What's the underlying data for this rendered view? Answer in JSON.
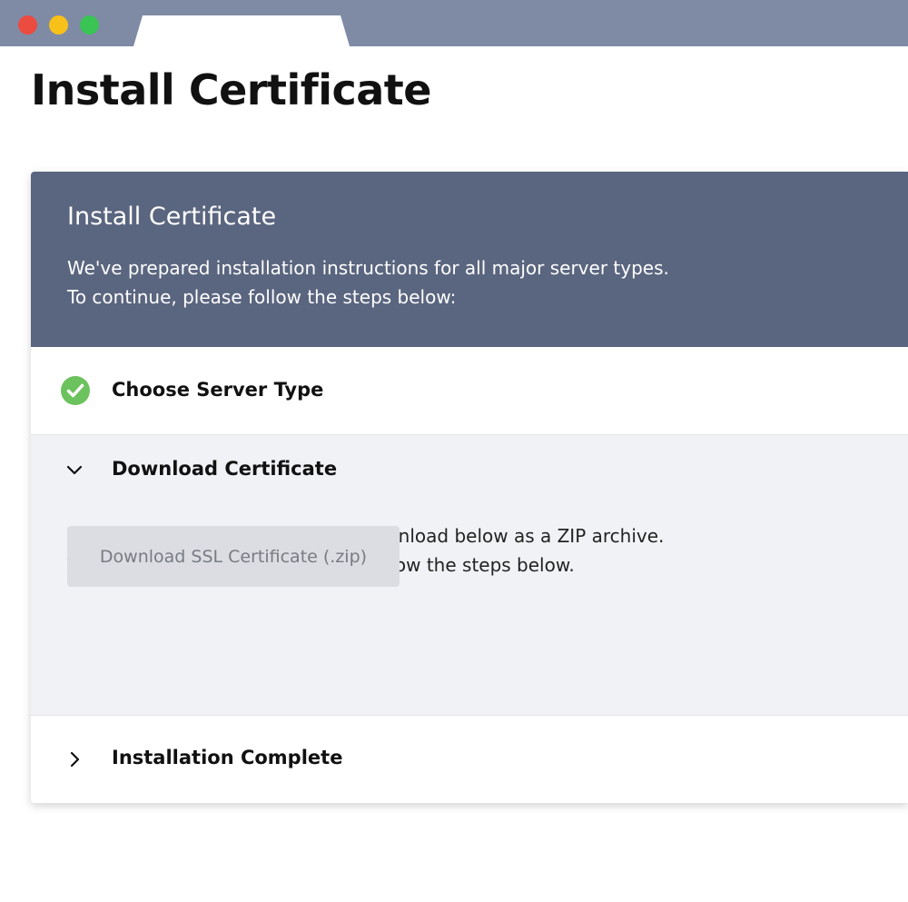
{
  "browser": {
    "traffic_lights": [
      {
        "name": "close",
        "color": "#ec4b40"
      },
      {
        "name": "minimize",
        "color": "#f8c11a"
      },
      {
        "name": "maximize",
        "color": "#39c454"
      }
    ]
  },
  "page": {
    "title": "Install Certificate"
  },
  "card": {
    "title": "Install Certificate",
    "description_line_1": "We've prepared installation instructions for all major server types.",
    "description_line_2": "To continue, please follow the steps below:"
  },
  "steps": [
    {
      "label": "Choose Server Type",
      "state": "complete",
      "icon": "check-circle-icon"
    },
    {
      "label": "Download Certificate",
      "state": "expanded",
      "icon": "chevron-down-icon",
      "body_line_1": "Your certificate is now ready for download below as a ZIP archive.",
      "body_line_2": "To install your certificate, simply follow the steps below.",
      "button_label": "Download SSL Certificate (.zip)"
    },
    {
      "label": "Installation Complete",
      "state": "collapsed",
      "icon": "chevron-right-icon"
    }
  ],
  "colors": {
    "titlebar": "#7f8aa5",
    "header": "#5a657f",
    "success": "#6cc25d",
    "expanded_background": "#f1f2f5",
    "button": "#dcdde2"
  }
}
